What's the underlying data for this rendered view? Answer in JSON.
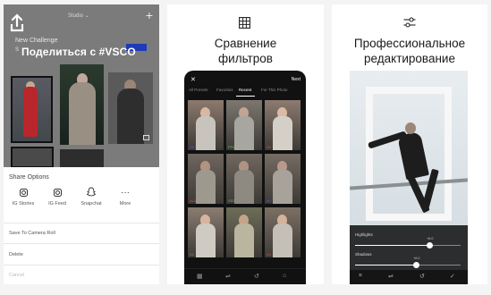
{
  "panel1": {
    "topbar": {
      "studio_label": "Studio",
      "studio_chevron": "⌄",
      "plus": "+"
    },
    "challenge_title": "New Challenge",
    "challenge_sub": "S",
    "caption": "Поделиться с #VSCO",
    "share": {
      "title": "Share Options",
      "options": [
        {
          "label": "IG Stories",
          "icon": "instagram-icon"
        },
        {
          "label": "IG Feed",
          "icon": "instagram-icon"
        },
        {
          "label": "Snapchat",
          "icon": "snapchat-icon"
        },
        {
          "label": "More",
          "icon": "more-icon"
        }
      ],
      "save_to_camera_roll": "Save To Camera Roll",
      "delete": "Delete",
      "cancel": "Cancel"
    },
    "colors": {
      "accent_bar": "#1f3ab8"
    }
  },
  "panel2": {
    "title_line1": "Сравнение",
    "title_line2": "фильтров",
    "icon": "grid-icon",
    "phone": {
      "close": "✕",
      "next": "Next",
      "tabs": [
        "All Presets",
        "Favorites",
        "Recent",
        "For This Photo"
      ],
      "active_tab": "Recent",
      "filters": [
        {
          "label": "AK1",
          "color": "#5b4ee0"
        },
        {
          "label": "FP4",
          "color": "#5fbf63"
        },
        {
          "label": "A9",
          "color": "#e24a3c"
        },
        {
          "label": "AL3",
          "color": "#e24a3c"
        },
        {
          "label": "SS3",
          "color": "#5fbf63"
        },
        {
          "label": "M3",
          "color": "#5b4ee0"
        },
        {
          "label": "C1",
          "color": "#5fbf63"
        },
        {
          "label": "",
          "color": "#5fbf63"
        },
        {
          "label": "A4",
          "color": "#e24a3c"
        }
      ],
      "bottom_icons": [
        "grid-icon",
        "sliders-icon",
        "history-icon",
        "bookmark-icon"
      ]
    }
  },
  "panel3": {
    "title_line1": "Профессиональное",
    "title_line2": "редактирование",
    "icon": "sliders-icon",
    "phone": {
      "sliders": [
        {
          "label": "Highlights",
          "value_text": "+6.0",
          "level": 0.7
        },
        {
          "label": "Shadows",
          "value_text": "+6.0",
          "level": 0.58
        }
      ],
      "bottom_icons": [
        "crop-icon",
        "sliders-icon",
        "history-icon",
        "check-icon"
      ]
    }
  }
}
